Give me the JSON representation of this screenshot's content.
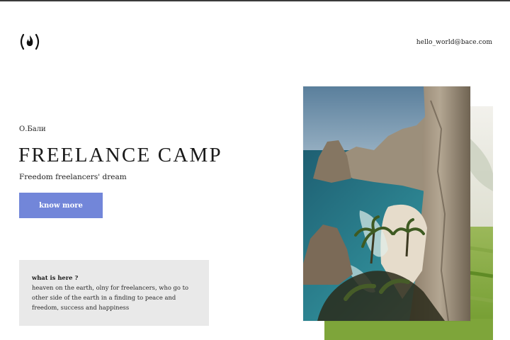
{
  "header": {
    "logo_icon": "flame-logo-icon",
    "email": "hello_world@bace.com"
  },
  "hero": {
    "location": "О.Бали",
    "title": "FREELANCE CAMP",
    "subtitle": "Freedom freelancers' dream",
    "cta_label": "know more",
    "cta_color": "#7286d9"
  },
  "info": {
    "heading": "what is here ?",
    "text": "heaven on the earth, olny for freelancers, who go to other side of the earth in a finding to peace and freedom, success and happiness"
  },
  "gallery": {
    "front_photo": "cliff-beach-photo",
    "back_photo": "rice-terrace-photo"
  }
}
